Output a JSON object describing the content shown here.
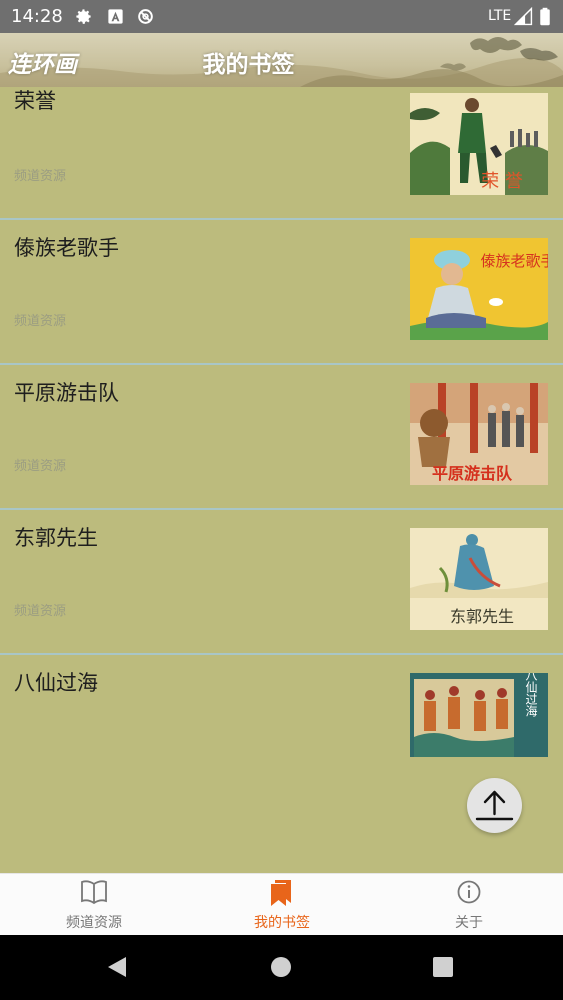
{
  "status_bar": {
    "time": "14:28",
    "network": "LTE"
  },
  "app_bar": {
    "brand": "连环画",
    "title": "我的书签"
  },
  "items": [
    {
      "title": "荣誉",
      "source": "频道资源",
      "cover_text": "荣 誉"
    },
    {
      "title": "傣族老歌手",
      "source": "频道资源",
      "cover_text": "傣族老歌手"
    },
    {
      "title": "平原游击队",
      "source": "频道资源",
      "cover_text": "平原游击队"
    },
    {
      "title": "东郭先生",
      "source": "频道资源",
      "cover_text": "东郭先生"
    },
    {
      "title": "八仙过海",
      "source": "",
      "cover_text": "八仙过海"
    }
  ],
  "bottom_nav": {
    "tabs": [
      {
        "label": "频道资源",
        "icon": "book-open-icon"
      },
      {
        "label": "我的书签",
        "icon": "bookmark-icon"
      },
      {
        "label": "关于",
        "icon": "info-icon"
      }
    ],
    "active_index": 1
  },
  "colors": {
    "list_background": "#bcbb7d",
    "divider": "#a9c6c7",
    "active_tab": "#e8651a",
    "status_bar": "#6f6f6f"
  }
}
